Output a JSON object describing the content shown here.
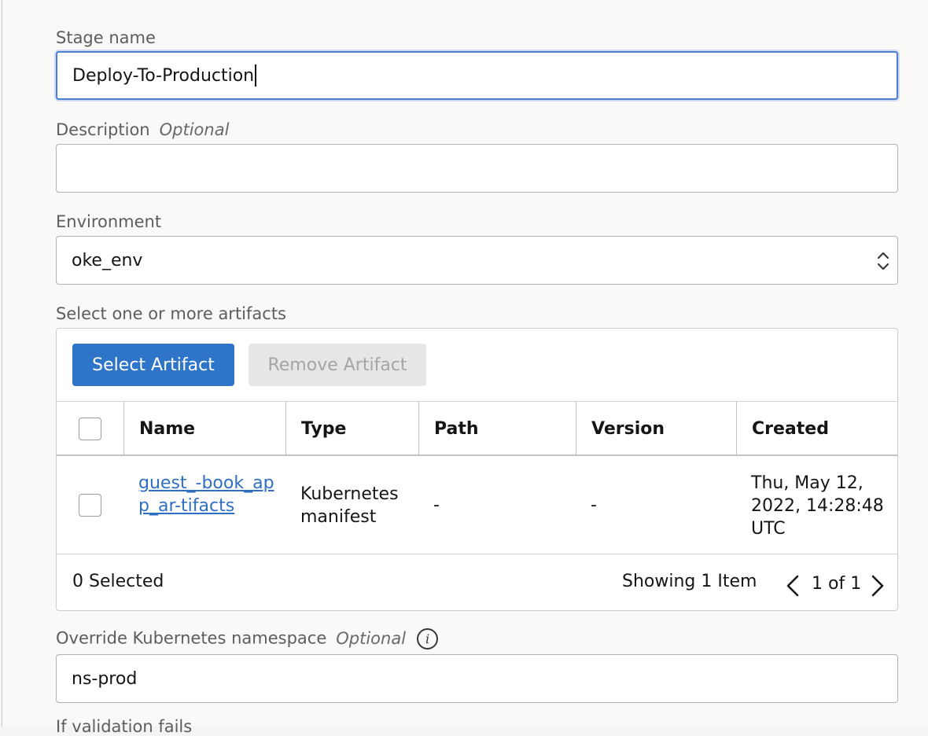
{
  "stage_name": {
    "label": "Stage name",
    "value": "Deploy-To-Production"
  },
  "description": {
    "label": "Description",
    "optional": "Optional",
    "value": ""
  },
  "environment": {
    "label": "Environment",
    "value": "oke_env"
  },
  "artifacts": {
    "label": "Select one or more artifacts",
    "select_button": "Select Artifact",
    "remove_button": "Remove Artifact",
    "columns": [
      "Name",
      "Type",
      "Path",
      "Version",
      "Created"
    ],
    "rows": [
      {
        "name": "guest_-book_app_ar-tifacts",
        "type": "Kubernetes manifest",
        "path": "-",
        "version": "-",
        "created": "Thu, May 12, 2022, 14:28:48 UTC"
      }
    ],
    "selected_count": "0 Selected",
    "showing": "Showing 1 Item",
    "pagination": "1 of 1"
  },
  "namespace": {
    "label": "Override Kubernetes namespace",
    "optional": "Optional",
    "value": "ns-prod"
  },
  "next_label": "If validation fails"
}
